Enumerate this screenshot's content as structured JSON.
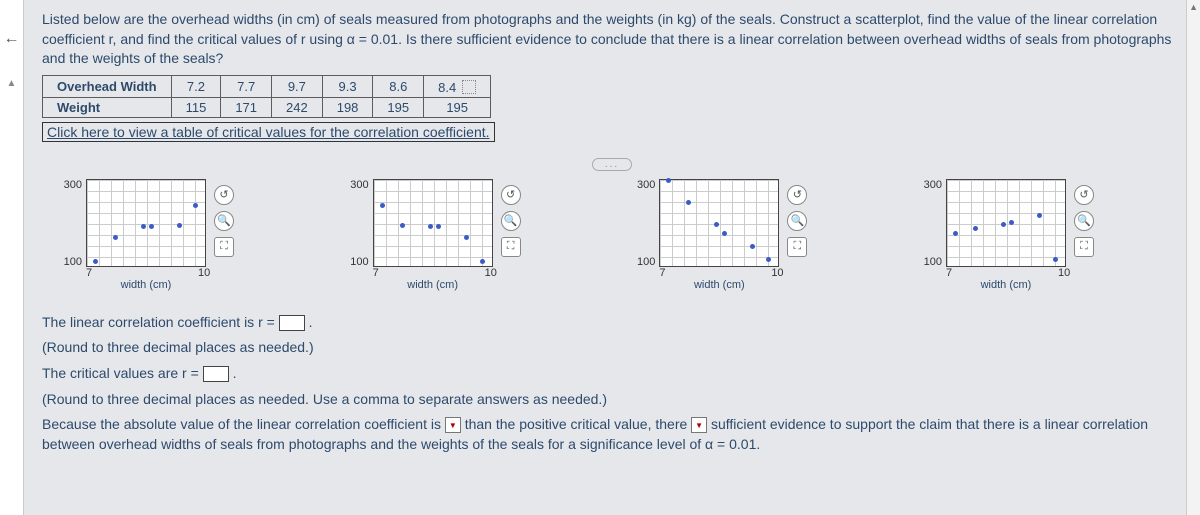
{
  "prompt": "Listed below are the overhead widths (in cm) of seals measured from photographs and the weights (in kg) of the seals. Construct a scatterplot, find the value of the linear correlation coefficient r, and find the critical values of r using α = 0.01. Is there sufficient evidence to conclude that there is a linear correlation between overhead widths of seals from photographs and the weights of the seals?",
  "table": {
    "row_labels": [
      "Overhead Width",
      "Weight"
    ],
    "cols": [
      "7.2",
      "7.7",
      "9.7",
      "9.3",
      "8.6",
      "8.4"
    ],
    "weights": [
      "115",
      "171",
      "242",
      "198",
      "195",
      "195"
    ]
  },
  "link_text": "Click here to view a table of critical values for the correlation coefficient.",
  "ellipsis": "...",
  "chart_options": [
    {
      "xlabel": "width (cm)",
      "xmin": "7",
      "xmax": "10",
      "y_hi": "300",
      "y_lo": "100",
      "points": [
        [
          7.2,
          115
        ],
        [
          7.7,
          171
        ],
        [
          8.4,
          195
        ],
        [
          8.6,
          195
        ],
        [
          9.3,
          198
        ],
        [
          9.7,
          242
        ]
      ]
    },
    {
      "xlabel": "width (cm)",
      "xmin": "7",
      "xmax": "10",
      "y_hi": "300",
      "y_lo": "100",
      "points": [
        [
          7.2,
          242
        ],
        [
          7.7,
          198
        ],
        [
          8.4,
          195
        ],
        [
          8.6,
          195
        ],
        [
          9.3,
          171
        ],
        [
          9.7,
          115
        ]
      ]
    },
    {
      "xlabel": "width (cm)",
      "xmin": "7",
      "xmax": "10",
      "y_hi": "300",
      "y_lo": "100",
      "points": [
        [
          7.2,
          300
        ],
        [
          7.7,
          250
        ],
        [
          8.4,
          200
        ],
        [
          8.6,
          180
        ],
        [
          9.3,
          150
        ],
        [
          9.7,
          120
        ]
      ]
    },
    {
      "xlabel": "width (cm)",
      "xmin": "7",
      "xmax": "10",
      "y_hi": "300",
      "y_lo": "100",
      "points": [
        [
          7.2,
          180
        ],
        [
          7.7,
          190
        ],
        [
          8.4,
          200
        ],
        [
          8.6,
          205
        ],
        [
          9.3,
          220
        ],
        [
          9.7,
          120
        ]
      ]
    }
  ],
  "q1_pre": "The linear correlation coefficient is r = ",
  "q1_post": ".",
  "q1_hint": "(Round to three decimal places as needed.)",
  "q2_pre": "The critical values are r = ",
  "q2_post": ".",
  "q2_hint": "(Round to three decimal places as needed. Use a comma to separate answers as needed.)",
  "q3_a": "Because the absolute value of the linear correlation coefficient is",
  "q3_b": "than the positive critical value, there",
  "q3_c": "sufficient evidence to support the claim that there is a linear correlation between overhead widths of seals from photographs and the weights of the seals for a significance level of α = 0.01.",
  "chart_data": {
    "type": "scatter",
    "title": "",
    "xlabel": "width (cm)",
    "ylabel": "",
    "xlim": [
      7,
      10
    ],
    "ylim": [
      100,
      300
    ],
    "series": [
      {
        "name": "seals",
        "x": [
          7.2,
          7.7,
          9.7,
          9.3,
          8.6,
          8.4
        ],
        "y": [
          115,
          171,
          242,
          198,
          195,
          195
        ]
      }
    ]
  }
}
